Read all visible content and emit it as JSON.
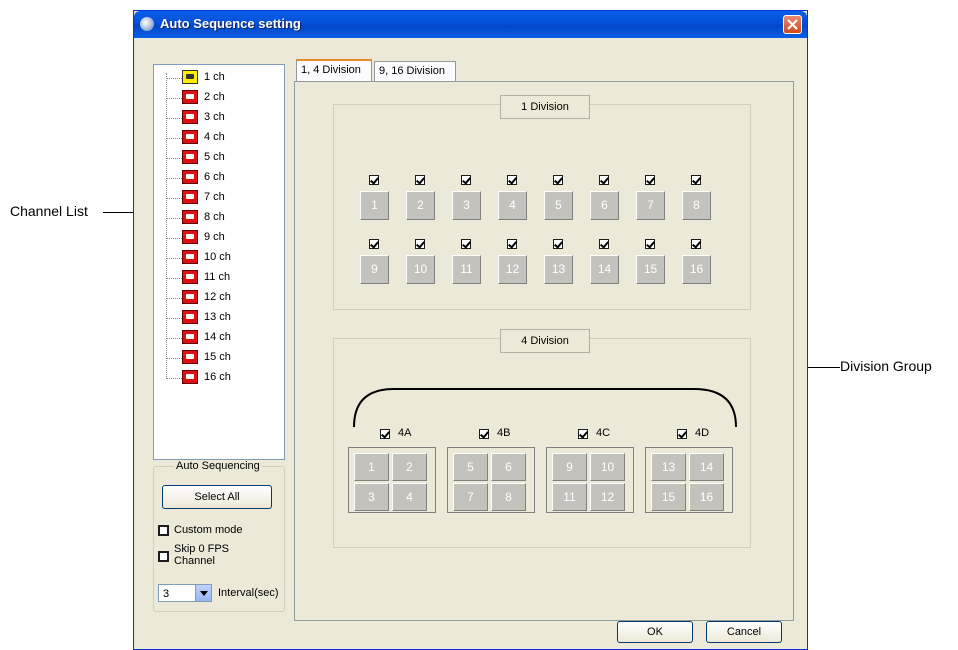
{
  "window": {
    "title": "Auto Sequence setting"
  },
  "callouts": {
    "channel_list": "Channel List",
    "division_group": "Division Group"
  },
  "channels": [
    "1 ch",
    "2 ch",
    "3 ch",
    "4 ch",
    "5 ch",
    "6 ch",
    "7 ch",
    "8 ch",
    "9 ch",
    "10 ch",
    "11 ch",
    "12 ch",
    "13 ch",
    "14 ch",
    "15 ch",
    "16 ch"
  ],
  "auto_sequencing": {
    "legend": "Auto Sequencing",
    "select_all": "Select All",
    "custom_mode": "Custom mode",
    "skip_line1": "Skip 0 FPS",
    "skip_line2": "Channel",
    "interval_value": "3",
    "interval_label": "Interval(sec)"
  },
  "tabs": [
    "1, 4 Division",
    "9, 16 Division"
  ],
  "one_division": {
    "title": "1 Division",
    "row1": [
      "1",
      "2",
      "3",
      "4",
      "5",
      "6",
      "7",
      "8"
    ],
    "row2": [
      "9",
      "10",
      "11",
      "12",
      "13",
      "14",
      "15",
      "16"
    ]
  },
  "four_division": {
    "title": "4 Division",
    "groups": [
      {
        "label": "4A",
        "cells": [
          "1",
          "2",
          "3",
          "4"
        ]
      },
      {
        "label": "4B",
        "cells": [
          "5",
          "6",
          "7",
          "8"
        ]
      },
      {
        "label": "4C",
        "cells": [
          "9",
          "10",
          "11",
          "12"
        ]
      },
      {
        "label": "4D",
        "cells": [
          "13",
          "14",
          "15",
          "16"
        ]
      }
    ]
  },
  "footer": {
    "ok": "OK",
    "cancel": "Cancel"
  }
}
